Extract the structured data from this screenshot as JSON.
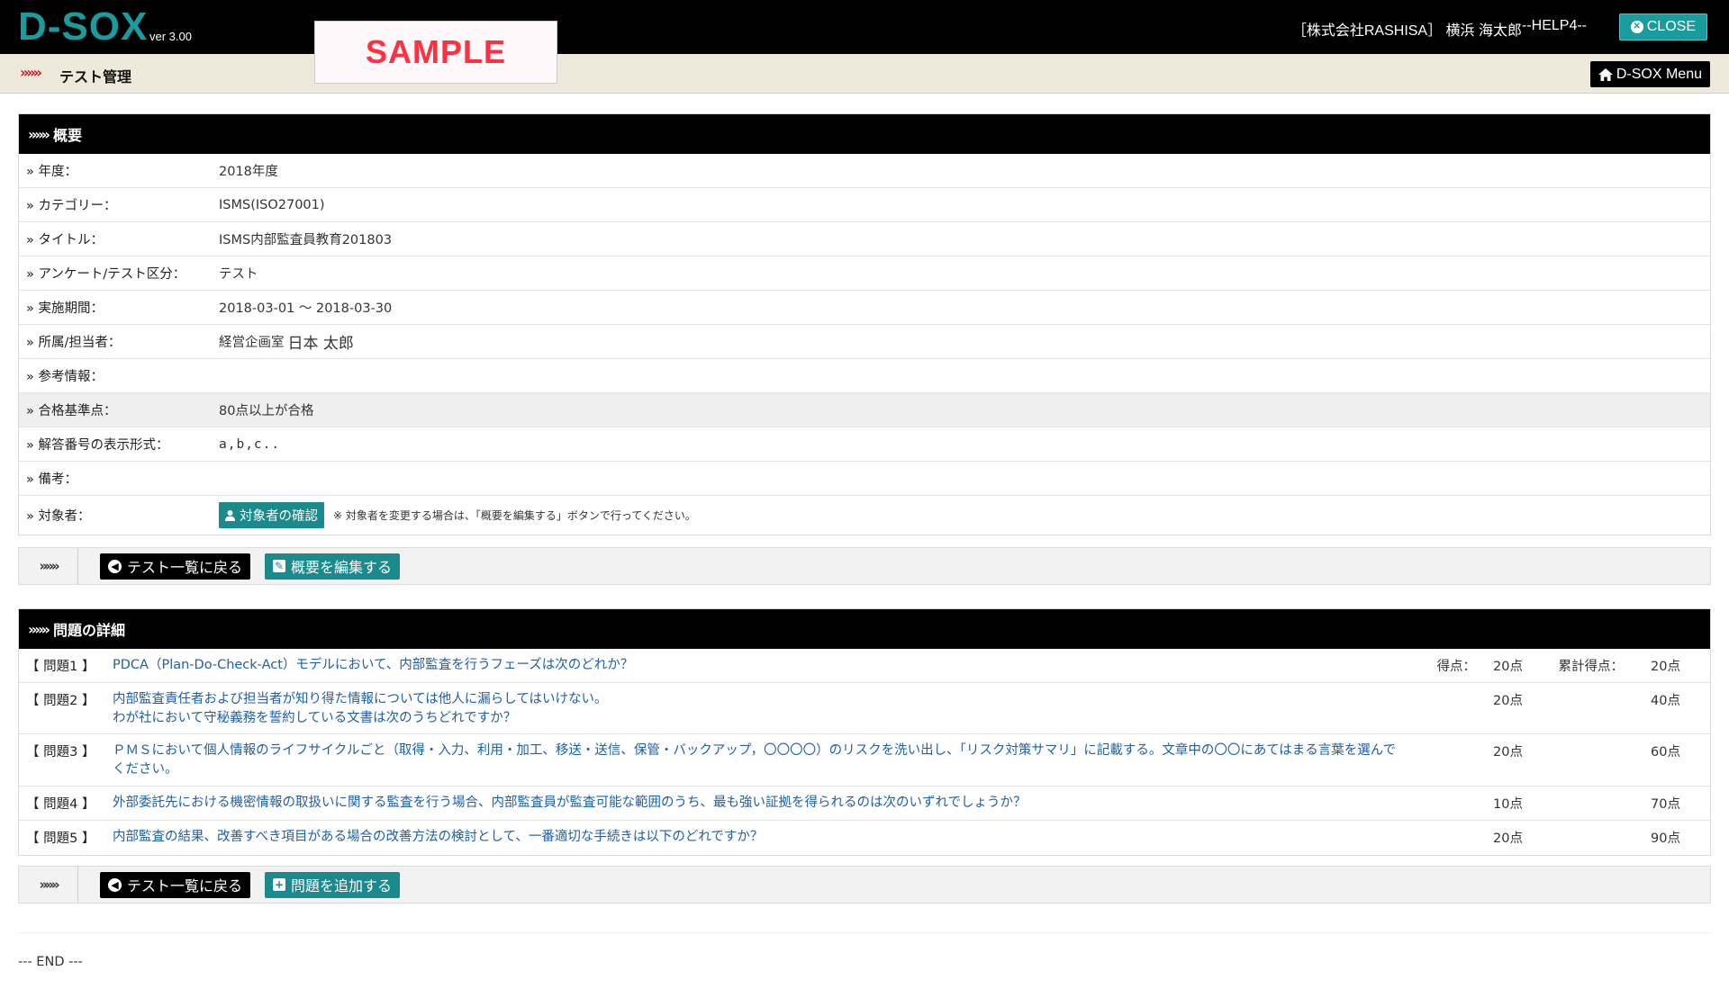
{
  "header": {
    "logo": "D-SOX",
    "version": "ver 3.00",
    "sample": "SAMPLE",
    "user": "［株式会社RASHISA］ 横浜 海太郎",
    "help": "--HELP4--",
    "close_label": "CLOSE"
  },
  "breadcrumb": {
    "arrows": "»»»",
    "title": "テスト管理",
    "menu_label": "D-SOX Menu"
  },
  "overview": {
    "heading_arrows": "»»»",
    "heading": "概要",
    "rows": [
      {
        "label": "» 年度：",
        "value": "2018年度"
      },
      {
        "label": "» カテゴリー：",
        "value": "ISMS(ISO27001)"
      },
      {
        "label": "» タイトル：",
        "value": "ISMS内部監査員教育201803"
      },
      {
        "label": "» アンケート/テスト区分：",
        "value": "テスト"
      },
      {
        "label": "» 実施期間：",
        "value": "2018-03-01 ～ 2018-03-30"
      },
      {
        "label": "» 所属/担当者：",
        "value_dept": "経営企画室",
        "value_person": "日本 太郎"
      },
      {
        "label": "» 参考情報：",
        "value": ""
      },
      {
        "label": "» 合格基準点：",
        "value": "80点以上が合格"
      },
      {
        "label": "» 解答番号の表示形式：",
        "value": "a,b,c.."
      },
      {
        "label": "» 備考：",
        "value": ""
      },
      {
        "label": "» 対象者：",
        "button": "対象者の確認",
        "note": "※ 対象者を変更する場合は、「概要を編集する」ボタンで行ってください。"
      }
    ]
  },
  "actions1": {
    "arrows": "»»»",
    "back_label": "テスト一覧に戻る",
    "edit_label": "概要を編集する"
  },
  "questions": {
    "heading_arrows": "»»»",
    "heading": "問題の詳細",
    "score_label": "得点：",
    "cum_label": "累計得点：",
    "items": [
      {
        "no": "【 問題1 】",
        "line1": "PDCA（Plan-Do-Check-Act）モデルにおいて、内部監査を行うフェーズは次のどれか？",
        "line2": "",
        "score": "20点",
        "cum": "20点"
      },
      {
        "no": "【 問題2 】",
        "line1": "内部監査責任者および担当者が知り得た情報については他人に漏らしてはいけない。",
        "line2": "わが社において守秘義務を誓約している文書は次のうちどれですか？",
        "score": "20点",
        "cum": "40点"
      },
      {
        "no": "【 問題3 】",
        "line1": "ＰＭＳにおいて個人情報のライフサイクルごと（取得・入力、利用・加工、移送・送信、保管・バックアップ，〇〇〇〇）のリスクを洗い出し、「リスク対策サマリ」に記載する。文章中の〇〇にあてはまる言葉を選んで",
        "line2": "ください。",
        "score": "20点",
        "cum": "60点"
      },
      {
        "no": "【 問題4 】",
        "line1": "外部委託先における機密情報の取扱いに関する監査を行う場合、内部監査員が監査可能な範囲のうち、最も強い証拠を得られるのは次のいずれでしょうか？",
        "line2": "",
        "score": "10点",
        "cum": "70点"
      },
      {
        "no": "【 問題5 】",
        "line1": "内部監査の結果、改善すべき項目がある場合の改善方法の検討として、一番適切な手続きは以下のどれですか？",
        "line2": "",
        "score": "20点",
        "cum": "90点"
      }
    ]
  },
  "actions2": {
    "arrows": "»»»",
    "back_label": "テスト一覧に戻る",
    "add_label": "問題を追加する"
  },
  "footer": {
    "end": "--- END ---"
  },
  "colors": {
    "brand_teal": "#1a9b9e",
    "sample_red": "#ff3040",
    "link_blue": "#1f5fa8",
    "crumb_bg": "#efe9dc"
  }
}
